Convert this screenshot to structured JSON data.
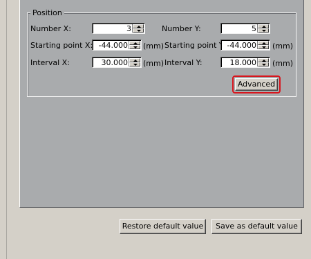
{
  "position_group": {
    "title": "Position",
    "number_x": {
      "label": "Number X:",
      "value": "3"
    },
    "number_y": {
      "label": "Number Y:",
      "value": "5"
    },
    "start_x": {
      "label": "Starting point X:",
      "value": "-44.000",
      "unit": "(mm)"
    },
    "start_y": {
      "label": "Starting point Y:",
      "value": "-44.000",
      "unit": "(mm)"
    },
    "interval_x": {
      "label": "Interval X:",
      "value": "30.000",
      "unit": "(mm)"
    },
    "interval_y": {
      "label": "Interval Y:",
      "value": "18.000",
      "unit": "(mm)"
    },
    "advanced_label": "Advanced"
  },
  "footer": {
    "restore_label": "Restore default value",
    "save_label": "Save as default value"
  },
  "colors": {
    "panel": "#a9abad",
    "dialog": "#d4d0c8",
    "highlight_outline": "#d9151d"
  }
}
